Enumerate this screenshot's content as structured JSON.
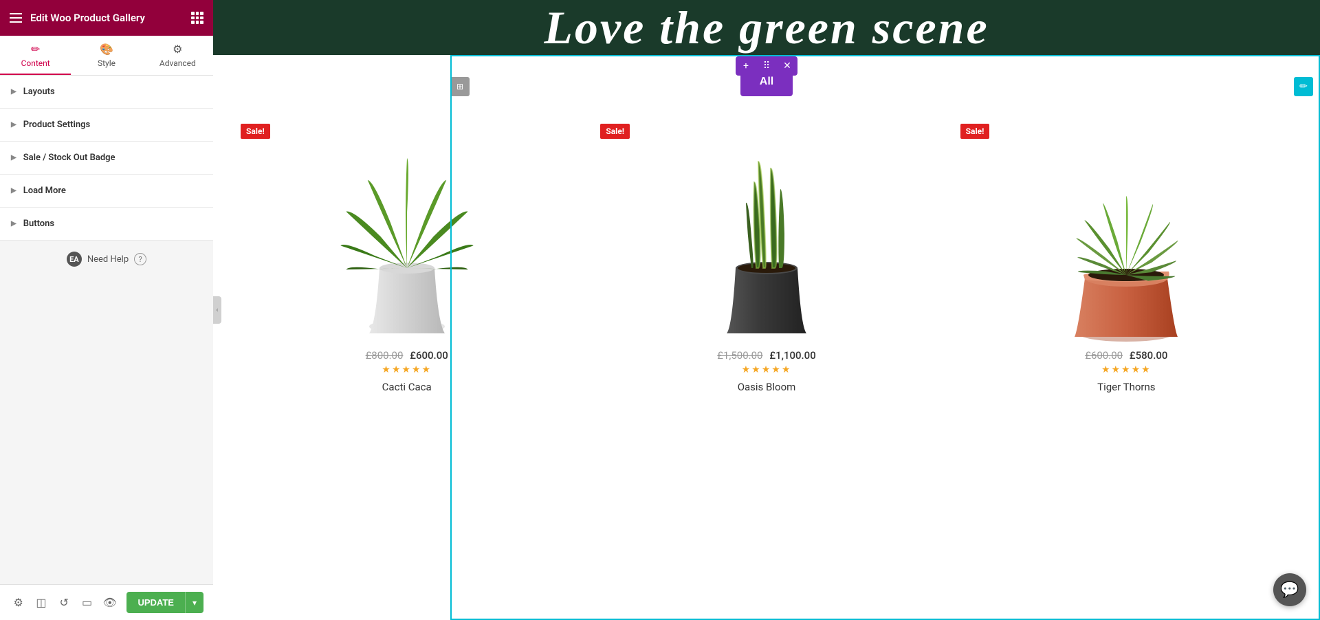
{
  "topBar": {
    "title": "Edit Woo Product Gallery",
    "hamburgerLabel": "hamburger menu",
    "gridLabel": "apps grid"
  },
  "tabs": [
    {
      "id": "content",
      "label": "Content",
      "icon": "✏️",
      "active": true
    },
    {
      "id": "style",
      "label": "Style",
      "icon": "🎨",
      "active": false
    },
    {
      "id": "advanced",
      "label": "Advanced",
      "icon": "⚙️",
      "active": false
    }
  ],
  "accordion": [
    {
      "id": "layouts",
      "label": "Layouts"
    },
    {
      "id": "product-settings",
      "label": "Product Settings"
    },
    {
      "id": "sale-badge",
      "label": "Sale / Stock Out Badge"
    },
    {
      "id": "load-more",
      "label": "Load More"
    },
    {
      "id": "buttons",
      "label": "Buttons"
    }
  ],
  "needHelp": {
    "badge": "EA",
    "text": "Need Help",
    "icon": "?"
  },
  "bottomBar": {
    "updateLabel": "UPDATE",
    "icons": [
      "settings",
      "layers",
      "history",
      "responsive",
      "eye"
    ]
  },
  "canvas": {
    "bannerText": "Love the green scene",
    "filterButton": "All",
    "products": [
      {
        "id": 1,
        "name": "Cacti Caca",
        "priceOld": "£800.00",
        "priceNew": "£600.00",
        "stars": "☆☆☆☆☆",
        "sale": true,
        "saleLabel": "Sale!"
      },
      {
        "id": 2,
        "name": "Oasis Bloom",
        "priceOld": "£1,500.00",
        "priceNew": "£1,100.00",
        "stars": "☆☆☆☆☆",
        "sale": true,
        "saleLabel": "Sale!"
      },
      {
        "id": 3,
        "name": "Tiger Thorns",
        "priceOld": "£600.00",
        "priceNew": "£580.00",
        "stars": "☆☆☆☆☆",
        "sale": true,
        "saleLabel": "Sale!"
      }
    ]
  },
  "colors": {
    "accent": "#92003b",
    "purple": "#7b2fbf",
    "cyan": "#00bcd4",
    "green": "#4caf50",
    "red": "#e02020"
  }
}
